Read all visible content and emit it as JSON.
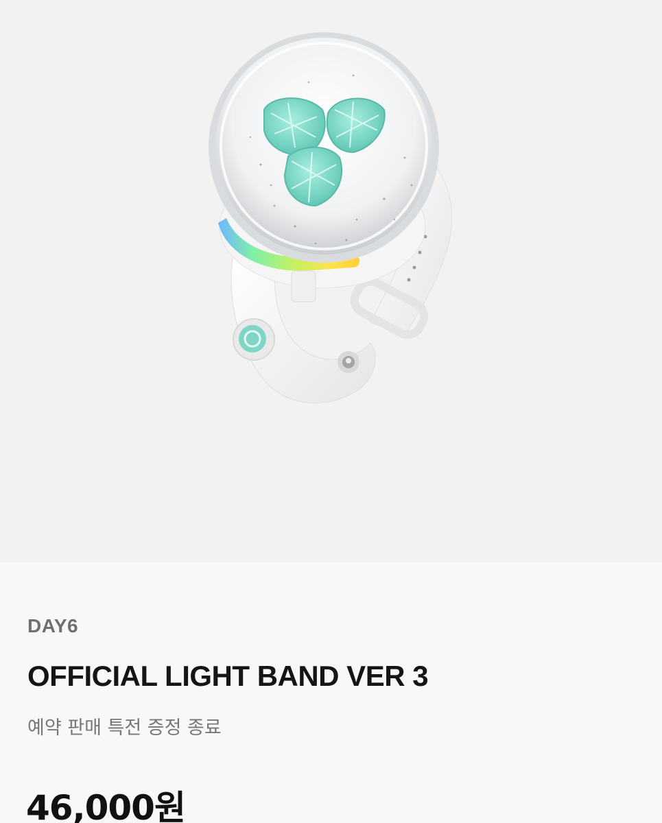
{
  "product": {
    "image_name": "day6-light-band-ver3",
    "artist": "DAY6",
    "title": "OFFICIAL LIGHT BAND VER 3",
    "subtitle": "예약 판매 특전 증정 종료",
    "price": "46,000원"
  },
  "colors": {
    "hero_background": "#f2f2f2",
    "info_background": "#f8f8f8",
    "band": "#f4f4f4",
    "mint_accent": "#7fd6c6"
  }
}
